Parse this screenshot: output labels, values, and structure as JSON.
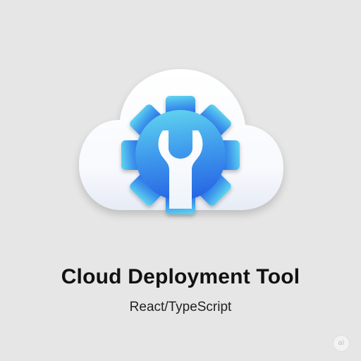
{
  "app": {
    "title": "Cloud Deployment Tool",
    "subtitle": "React/TypeScript"
  },
  "logo": {
    "icon": "cloud-gear-wrench-icon",
    "colors": {
      "cloud": "#ffffff",
      "gear_top": "#5fd2ef",
      "gear_bottom": "#2a68e6",
      "wrench": "#ffffff"
    }
  },
  "badge": {
    "text": "ai"
  },
  "colors": {
    "background": "#e6e6e6",
    "title": "#111111"
  }
}
